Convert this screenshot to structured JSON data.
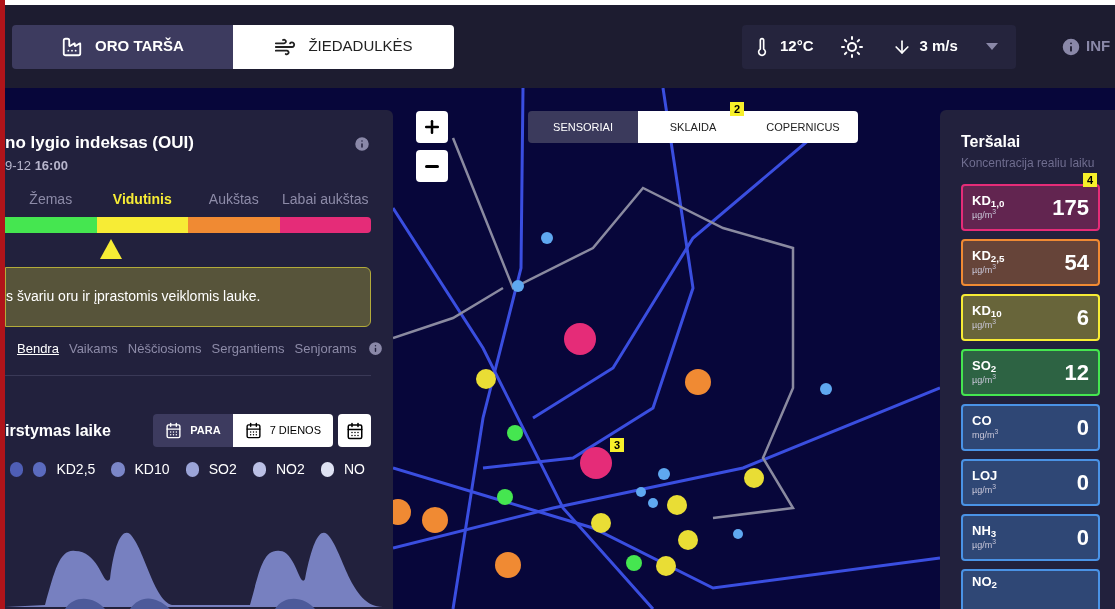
{
  "mode_tabs": [
    {
      "label": "ORO TARŠA",
      "selected": true
    },
    {
      "label": "ŽIEDADULKĖS",
      "selected": false
    }
  ],
  "weather": {
    "temperature": "12°C",
    "wind": "3 m/s"
  },
  "info_link": "INF",
  "index_panel": {
    "title": "no lygio indeksas (OUI)",
    "timestamp": "9-12 **16:00**",
    "levels": [
      {
        "label": "Žemas",
        "color": "#45e650",
        "selected": false
      },
      {
        "label": "Vidutinis",
        "color": "#f7ec35",
        "selected": true
      },
      {
        "label": "Aukštas",
        "color": "#f08a33",
        "selected": false
      },
      {
        "label": "Labai aukštas",
        "color": "#e52c78",
        "selected": false
      }
    ],
    "message": "s švariu oru ir įprastomis veiklomis lauke.",
    "audiences": [
      {
        "label": "Bendra",
        "selected": true
      },
      {
        "label": "Vaikams",
        "selected": false
      },
      {
        "label": "Nėščiosioms",
        "selected": false
      },
      {
        "label": "Sergantiems",
        "selected": false
      },
      {
        "label": "Senjorams",
        "selected": false
      }
    ]
  },
  "timeline": {
    "title": "irstymas laike",
    "periods": [
      {
        "label": "PARA",
        "selected": true
      },
      {
        "label": "7 DIENOS",
        "selected": false
      }
    ],
    "legend": [
      {
        "label": "KD2,5",
        "color": "#5b6bbf"
      },
      {
        "label": "KD10",
        "color": "#7b86c8"
      },
      {
        "label": "SO2",
        "color": "#9ba4d8"
      },
      {
        "label": "NO2",
        "color": "#bbc0e5"
      },
      {
        "label": "NO",
        "color": "#dfe2f3"
      }
    ]
  },
  "map": {
    "source_tabs": [
      {
        "label": "SENSORIAI",
        "selected": true
      },
      {
        "label": "SKLAIDA",
        "selected": false
      },
      {
        "label": "COPERNICUS",
        "selected": false
      }
    ],
    "sensors": [
      {
        "color": "#e52c78"
      },
      {
        "color": "#f08a33"
      },
      {
        "color": "#e9dd35"
      },
      {
        "color": "#45e650"
      },
      {
        "color": "#e52c78"
      },
      {
        "color": "#e9dd35"
      },
      {
        "color": "#45e650"
      },
      {
        "color": "#f08a33"
      },
      {
        "color": "#f08a33"
      },
      {
        "color": "#e9dd35"
      },
      {
        "color": "#e9dd35"
      },
      {
        "color": "#e9dd35"
      },
      {
        "color": "#e9dd35"
      },
      {
        "color": "#45e650"
      },
      {
        "color": "#f08a33"
      },
      {
        "color": "#5fa8f0"
      },
      {
        "color": "#5fa8f0"
      },
      {
        "color": "#5fa8f0"
      },
      {
        "color": "#5fa8f0"
      },
      {
        "color": "#5fa8f0"
      },
      {
        "color": "#5fa8f0"
      },
      {
        "color": "#5fa8f0"
      }
    ]
  },
  "annotations": [
    {
      "label": "2"
    },
    {
      "label": "3"
    },
    {
      "label": "4"
    }
  ],
  "pollutants": {
    "title": "Teršalai",
    "subtitle": "Koncentracija realiu laiku",
    "items": [
      {
        "name": "KD$_{1,0}$",
        "unit": "µg/m$^{3}$",
        "value": "175",
        "color": "#e52c78"
      },
      {
        "name": "KD$_{2,5}$",
        "unit": "µg/m$^{3}$",
        "value": "54",
        "color": "#f08a33"
      },
      {
        "name": "KD$_{10}$",
        "unit": "µg/m$^{3}$",
        "value": "6",
        "color": "#f7ec35"
      },
      {
        "name": "SO$_{2}$",
        "unit": "µg/m$^{3}$",
        "value": "12",
        "color": "#45e650"
      },
      {
        "name": "CO",
        "unit": "mg/m$^{3}$",
        "value": "0",
        "color": "#4a93e6"
      },
      {
        "name": "LOJ",
        "unit": "µg/m$^{3}$",
        "value": "0",
        "color": "#4a93e6"
      },
      {
        "name": "NH$_{3}$",
        "unit": "µg/m$^{3}$",
        "value": "0",
        "color": "#4a93e6"
      },
      {
        "name": "NO$_{2}$",
        "color": "#4a93e6"
      }
    ]
  }
}
